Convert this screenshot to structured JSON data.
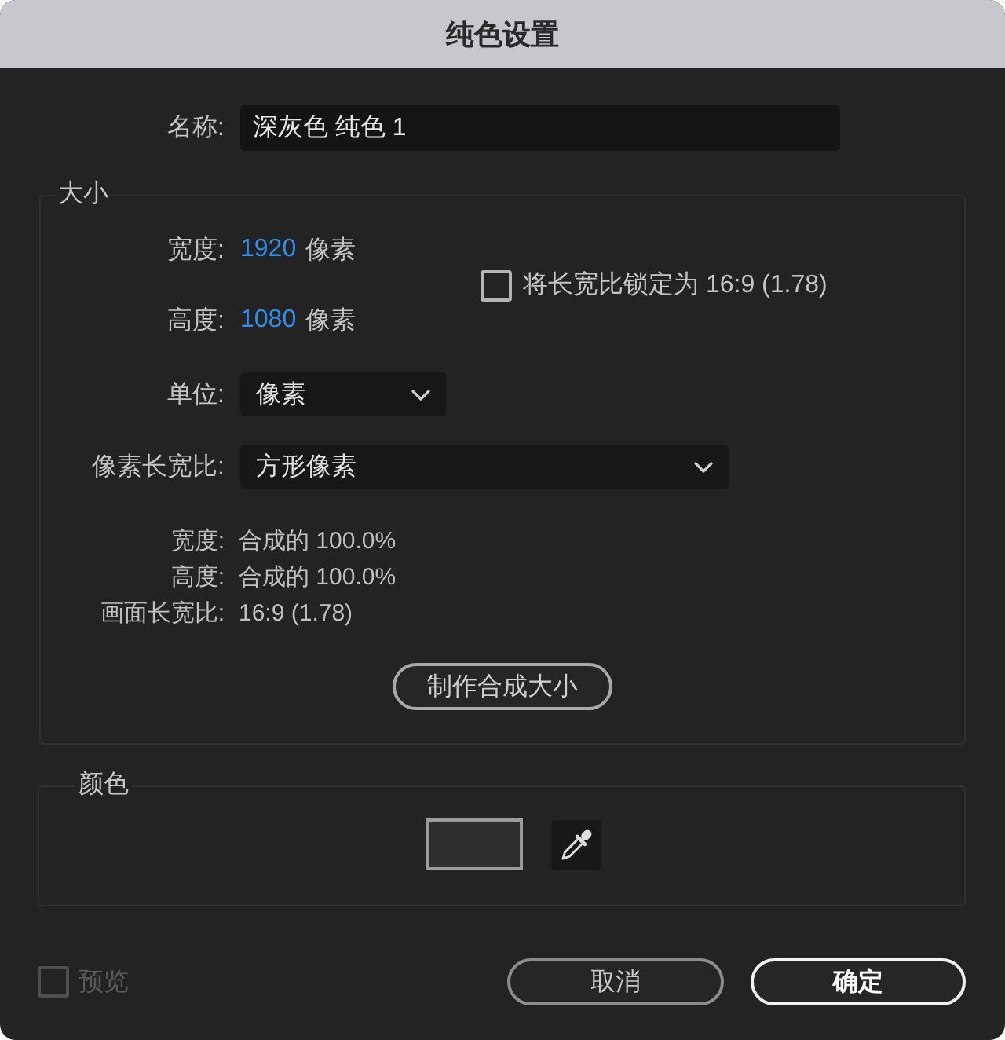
{
  "window": {
    "title": "纯色设置"
  },
  "name_field": {
    "label": "名称:",
    "value": "深灰色 纯色 1"
  },
  "size": {
    "title": "大小",
    "width": {
      "label": "宽度:",
      "value": "1920",
      "unit": "像素"
    },
    "height": {
      "label": "高度:",
      "value": "1080",
      "unit": "像素"
    },
    "lock_aspect": {
      "label": "将长宽比锁定为 16:9 (1.78)",
      "checked": false
    },
    "units": {
      "label": "单位:",
      "value": "像素"
    },
    "pixel_aspect": {
      "label": "像素长宽比:",
      "value": "方形像素"
    },
    "info": [
      {
        "label": "宽度:",
        "value": "合成的 100.0%"
      },
      {
        "label": "高度:",
        "value": "合成的 100.0%"
      },
      {
        "label": "画面长宽比:",
        "value": "16:9 (1.78)"
      }
    ],
    "button": "制作合成大小"
  },
  "color": {
    "title": "颜色",
    "swatch": {
      "color": "#2e2e2e"
    }
  },
  "preview": {
    "label": "预览",
    "checked": false,
    "disabled": true
  },
  "buttons": [
    {
      "label": "取消",
      "kind": "secondary"
    },
    {
      "label": "确定",
      "kind": "primary"
    }
  ]
}
